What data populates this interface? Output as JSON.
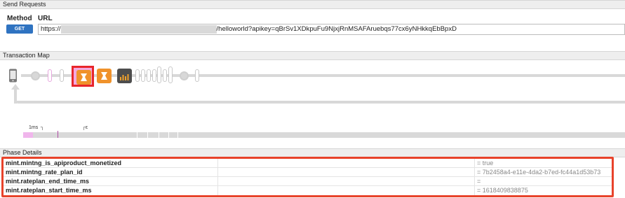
{
  "send_requests": {
    "title": "Send Requests",
    "method_label": "Method",
    "url_label": "URL",
    "method_button": "GET",
    "url_prefix": "https://",
    "url_suffix": "/helloworld?apikey=qBrSv1XDkpuFu9NjxjRnMSAFAruebqs77cx6yNHkkqEbBpxD"
  },
  "transaction_map": {
    "title": "Transaction Map",
    "timeline_labels": [
      "1ms",
      "ε"
    ]
  },
  "phase_details": {
    "title": "Phase Details",
    "rows": [
      {
        "name": "mint.mintng_is_apiproduct_monetized",
        "value": "= true"
      },
      {
        "name": "mint.mintng_rate_plan_id",
        "value": "= 7b2458a4-e11e-4da2-b7ed-fc44a1d53b73"
      },
      {
        "name": "mint.rateplan_end_time_ms",
        "value": "="
      },
      {
        "name": "mint.rateplan_start_time_ms",
        "value": "= 1618409838875"
      }
    ]
  },
  "colors": {
    "accent_blue": "#2f73c1",
    "highlight_red": "#e8432b",
    "policy_orange": "#f0922b",
    "selected_pink": "#f4a9df"
  }
}
